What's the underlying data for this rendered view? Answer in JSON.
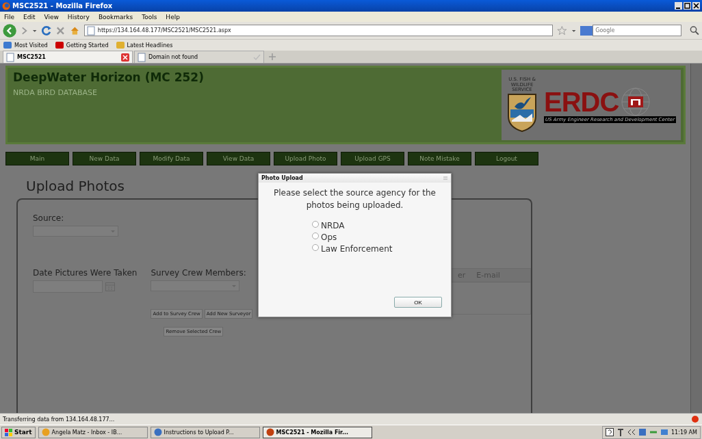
{
  "window": {
    "title": "MSC2521 - Mozilla Firefox"
  },
  "menu": [
    "File",
    "Edit",
    "View",
    "History",
    "Bookmarks",
    "Tools",
    "Help"
  ],
  "address_bar": {
    "value": "https://134.164.48.177/MSC2521/MSC2521.aspx"
  },
  "search": {
    "placeholder": "Google"
  },
  "bookmarks": [
    "Most Visited",
    "Getting Started",
    "Latest Headlines"
  ],
  "tabs": [
    {
      "label": "MSC2521",
      "selected": true
    },
    {
      "label": "Domain not found",
      "selected": false
    }
  ],
  "page": {
    "site_title": "DeepWater Horizon (MC 252)",
    "site_subtitle": "NRDA BIRD DATABASE",
    "logo": {
      "agency": "U.S. FISH & WILDLIFE SERVICE",
      "name": "ERDC",
      "caption": "US Army Engineer Research and Development Center"
    },
    "nav": [
      "Main",
      "New Data",
      "Modify Data",
      "View Data",
      "Upload Photo",
      "Upload GPS",
      "Note Mistake",
      "Logout"
    ],
    "heading": "Upload Photos",
    "form": {
      "source_label": "Source:",
      "date_label": "Date Pictures Were Taken",
      "crew_label": "Survey Crew Members:",
      "buttons": [
        "Add to Survey Crew",
        "Add New Surveyor"
      ],
      "remove_button": "Remove Selected Crew",
      "table_headers": [
        "er",
        "E-mail"
      ]
    }
  },
  "dialog": {
    "title": "Photo Upload",
    "message": "Please select the source agency for the photos being uploaded.",
    "options": [
      {
        "label": "NRDA",
        "selected": false
      },
      {
        "label": "Ops",
        "selected": false
      },
      {
        "label": "Law Enforcement",
        "selected": false
      }
    ],
    "ok": "OK"
  },
  "status_bar": "Transferring data from 134.164.48.177...",
  "taskbar": {
    "start": "Start",
    "items": [
      {
        "label": "Angela Matz - Inbox - IB...",
        "selected": false
      },
      {
        "label": "Instructions to Upload P...",
        "selected": false
      },
      {
        "label": "MSC2521 - Mozilla Fir...",
        "selected": true
      }
    ],
    "clock": "11:19 AM"
  }
}
